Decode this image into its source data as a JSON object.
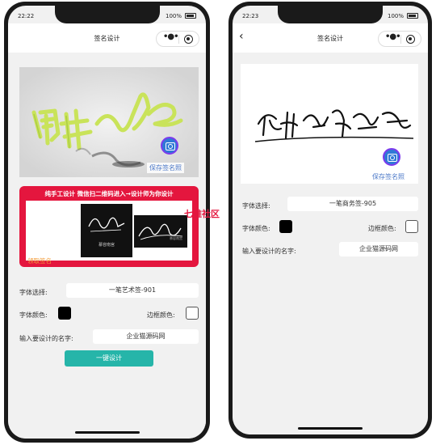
{
  "colors": {
    "accent_teal": "#26b5a9",
    "promo_red": "#e4163e",
    "font_color": "#000000",
    "border_color": "#ffffff"
  },
  "phone1": {
    "status": {
      "time": "22:22",
      "battery": "100%"
    },
    "nav": {
      "title": "签名设计",
      "menu_icon": "more-dots-icon",
      "target_icon": "target-icon"
    },
    "signature_image": {
      "save_label": "保存签名照",
      "save_icon": "camera-icon"
    },
    "promo": {
      "title": "纯手工设计 微信扫二维码进入→设计师为你设计",
      "card1_caption": "慕容南宫",
      "card2_caption": "慕容南宫",
      "claim_label": "领取签名"
    },
    "watermark": "七维社区",
    "form": {
      "font_label": "字体选择:",
      "font_value": "一笔艺术签-901",
      "font_color_label": "字体颜色:",
      "border_color_label": "边框颜色:",
      "name_label": "输入要设计的名字:",
      "name_value": "企业猫源码网"
    },
    "design_button": "一键设计"
  },
  "phone2": {
    "status": {
      "time": "22:23",
      "battery": "100%"
    },
    "nav": {
      "title": "签名设计",
      "back_icon": "chevron-left-icon",
      "menu_icon": "more-dots-icon",
      "target_icon": "target-icon"
    },
    "signature_image": {
      "save_label": "保存签名照",
      "save_icon": "camera-icon"
    },
    "form": {
      "font_label": "字体选择:",
      "font_value": "一笔商务签-905",
      "font_color_label": "字体颜色:",
      "border_color_label": "边框颜色:",
      "name_label": "输入要设计的名字:",
      "name_value": "企业猫源码网"
    }
  }
}
